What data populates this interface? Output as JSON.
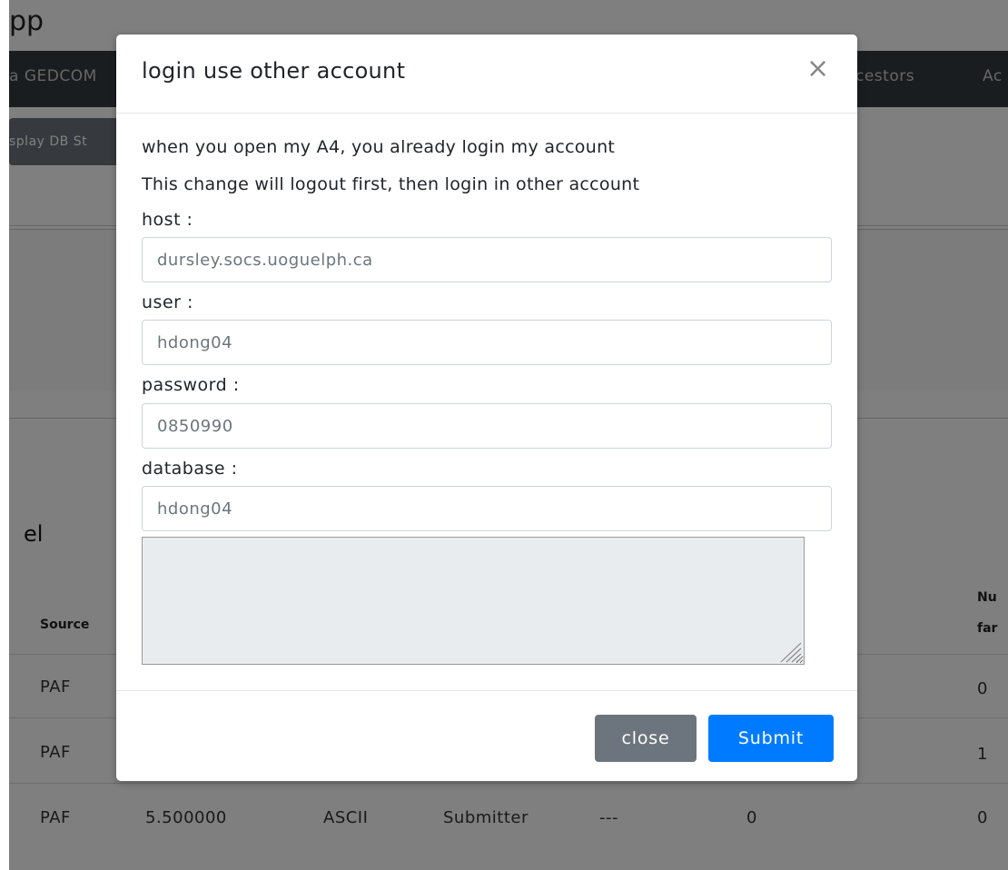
{
  "background": {
    "app_title": "pp",
    "nav": {
      "left_item": "a GEDCOM",
      "right_item_1": "cestors",
      "right_item_2": "Ac"
    },
    "sub_button": "splay DB St",
    "section_title": "el",
    "table": {
      "header_source": "Source",
      "header_right_line1": "Nu",
      "header_right_line2": "far",
      "rows": [
        {
          "source": "PAF",
          "version": "",
          "encoding": "",
          "submitter": "",
          "extra": "",
          "count": "",
          "right": "0"
        },
        {
          "source": "PAF",
          "version": "",
          "encoding": "",
          "submitter": "",
          "extra": "",
          "count": "",
          "right": "1"
        },
        {
          "source": "PAF",
          "version": "5.500000",
          "encoding": "ASCII",
          "submitter": "Submitter",
          "extra": "---",
          "count": "0",
          "right": "0"
        }
      ]
    }
  },
  "modal": {
    "title": "login use other account",
    "close_icon": "close-x-icon",
    "message_line1": "when you open my A4, you already login my account",
    "message_line2": "This change will logout first, then login in other account",
    "fields": {
      "host": {
        "label": "host :",
        "placeholder": "dursley.socs.uoguelph.ca",
        "value": ""
      },
      "user": {
        "label": "user :",
        "placeholder": "hdong04",
        "value": ""
      },
      "password": {
        "label": "password :",
        "placeholder": "0850990",
        "value": ""
      },
      "database": {
        "label": "database :",
        "placeholder": "hdong04",
        "value": ""
      }
    },
    "textarea_value": "",
    "buttons": {
      "close": "close",
      "submit": "Submit"
    }
  },
  "colors": {
    "submit_button": "#007bff",
    "close_button": "#6c757d",
    "nav_background": "#343a40"
  }
}
